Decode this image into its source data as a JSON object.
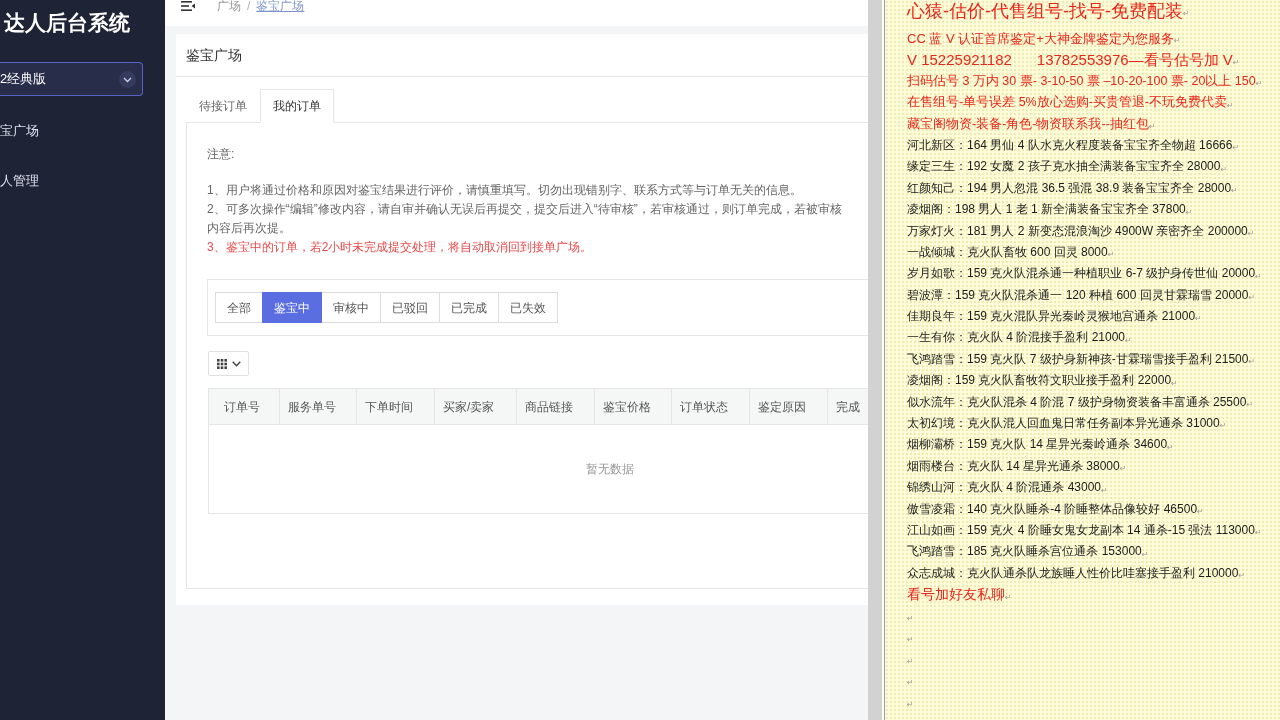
{
  "sidebar": {
    "title": "达人后台系统",
    "version_select": {
      "value": "2经典版"
    },
    "items": [
      {
        "label": "宝广场"
      },
      {
        "label": "人管理"
      }
    ]
  },
  "top_bar": {
    "breadcrumb": [
      {
        "label": "广场",
        "kind": "plain"
      },
      {
        "label": "鉴宝广场",
        "kind": "link"
      }
    ],
    "separator": "/"
  },
  "page": {
    "title": "鉴宝广场",
    "tabs": [
      {
        "label": "待接订单",
        "selected": false
      },
      {
        "label": "我的订单",
        "selected": true
      }
    ],
    "notice": {
      "heading": "注意:",
      "items": [
        {
          "kind": "normal",
          "lines": [
            "1、用户将通过价格和原因对鉴宝结果进行评价，请慎重填写。切勿出现错别字、联系方式等与订单无关的信息。"
          ]
        },
        {
          "kind": "normal",
          "lines": [
            "2、可多次操作“编辑”修改内容，请自审并确认无误后再提交，提交后进入“待审核”，若审核通过，则订单完成，若被审核",
            "内容后再次提。"
          ]
        },
        {
          "kind": "warning",
          "lines": [
            "3、鉴宝中的订单，若2小时未完成提交处理，将自动取消回到接单广场。"
          ]
        }
      ]
    },
    "status_filter": [
      {
        "label": "全部",
        "selected": false
      },
      {
        "label": "鉴宝中",
        "selected": true
      },
      {
        "label": "审核中",
        "selected": false
      },
      {
        "label": "已驳回",
        "selected": false
      },
      {
        "label": "已完成",
        "selected": false
      },
      {
        "label": "已失效",
        "selected": false
      }
    ],
    "table": {
      "columns": [
        "订单号",
        "服务单号",
        "下单时间",
        "买家/卖家",
        "商品链接",
        "鉴宝价格",
        "订单状态",
        "鉴定原因",
        "完成"
      ],
      "empty_text": "暂无数据"
    }
  },
  "document": {
    "lines": [
      {
        "kind": "title",
        "text": "心猿-估价-代售组号-找号-免费配装",
        "mark": "↵"
      },
      {
        "kind": "headline",
        "text": "CC 蓝 V 认证首席鉴定+大神金牌鉴定为您服务",
        "mark": "↵"
      },
      {
        "kind": "contact",
        "text": "V 15225921182      13782553976—看号估号加 V",
        "mark": "↵"
      },
      {
        "kind": "promo",
        "text": "扫码估号 3 万内 30 票- 3-10-50 票 –10-20-100 票- 20以上 150",
        "mark": "↵"
      },
      {
        "kind": "promo",
        "text": "在售组号-单号误差 5%放心选购-买贵管退-不玩免费代卖",
        "mark": "↵"
      },
      {
        "kind": "promo",
        "text": "藏宝阁物资-装备-角色-物资联系我--抽红包",
        "mark": "↵"
      },
      {
        "kind": "listing",
        "text": "河北新区：164 男仙 4 队水克火程度装备宝宝齐全物超 16666",
        "mark": "↵"
      },
      {
        "kind": "listing",
        "text": "缘定三生：192 女魔 2 孩子克水抽全满装备宝宝齐全 28000",
        "mark": "↵"
      },
      {
        "kind": "listing",
        "text": "红颜知己：194 男人忽混 36.5 强混 38.9 装备宝宝齐全 28000",
        "mark": "↵"
      },
      {
        "kind": "listing",
        "text": "凌烟阁：198 男人 1 老 1 新全满装备宝宝齐全 37800",
        "mark": "↵"
      },
      {
        "kind": "listing",
        "text": "万家灯火：181 男人 2 新变态混浪淘沙 4900W 亲密齐全 200000",
        "mark": "↵"
      },
      {
        "kind": "listing",
        "text": "一战倾城：克火队畜牧 600 回灵 8000",
        "mark": "↵"
      },
      {
        "kind": "listing",
        "text": "岁月如歌：159 克火队混杀通一种植职业 6-7 级护身传世仙 20000",
        "mark": "↵"
      },
      {
        "kind": "listing",
        "text": "碧波潭：159 克火队混杀通一 120 种植 600 回灵甘霖瑞雪 20000",
        "mark": "↵"
      },
      {
        "kind": "listing",
        "text": "佳期良年：159 克火混队异光秦岭灵猴地宫通杀 21000",
        "mark": "↵"
      },
      {
        "kind": "listing",
        "text": "一生有你：克火队 4 阶混接手盈利 21000",
        "mark": "↵"
      },
      {
        "kind": "listing",
        "text": "飞鸿踏雪：159 克火队 7 级护身新神孩-甘霖瑞雪接手盈利 21500",
        "mark": "↵"
      },
      {
        "kind": "listing",
        "text": "凌烟阁：159 克火队畜牧符文职业接手盈利 22000",
        "mark": "↵"
      },
      {
        "kind": "listing",
        "text": "似水流年：克火队混杀 4 阶混 7 级护身物资装备丰富通杀 25500",
        "mark": "↵"
      },
      {
        "kind": "listing",
        "text": "太初幻境：克火队混人回血鬼日常任务副本异光通杀 31000",
        "mark": "↵"
      },
      {
        "kind": "listing",
        "text": "烟柳灞桥：159 克火队 14 星异光秦岭通杀 34600",
        "mark": "↵"
      },
      {
        "kind": "listing",
        "text": "烟雨楼台：克火队 14 星异光通杀 38000",
        "mark": "↵"
      },
      {
        "kind": "listing",
        "text": "锦绣山河：克火队 4 阶混通杀 43000",
        "mark": "↵"
      },
      {
        "kind": "listing",
        "text": "傲雪凌霜：140 克火队睡杀-4 阶睡整体品像较好 46500",
        "mark": "↵"
      },
      {
        "kind": "listing",
        "text": "江山如画：159 克火 4 阶睡女鬼女龙副本 14 通杀-15 强法 113000",
        "mark": "↵"
      },
      {
        "kind": "listing",
        "text": "飞鸿踏雪：185 克火队睡杀宫位通杀 153000",
        "mark": "↵"
      },
      {
        "kind": "listing",
        "text": "众志成城：克火队通杀队龙族睡人性价比哇塞接手盈利 210000",
        "mark": "↵"
      },
      {
        "kind": "note",
        "text": "看号加好友私聊",
        "mark": "↵"
      },
      {
        "kind": "blank",
        "mark": "↵"
      },
      {
        "kind": "blank",
        "mark": "↵"
      },
      {
        "kind": "blank",
        "mark": "↵"
      },
      {
        "kind": "blank",
        "mark": "↵"
      },
      {
        "kind": "blank",
        "mark": "↵"
      }
    ]
  }
}
